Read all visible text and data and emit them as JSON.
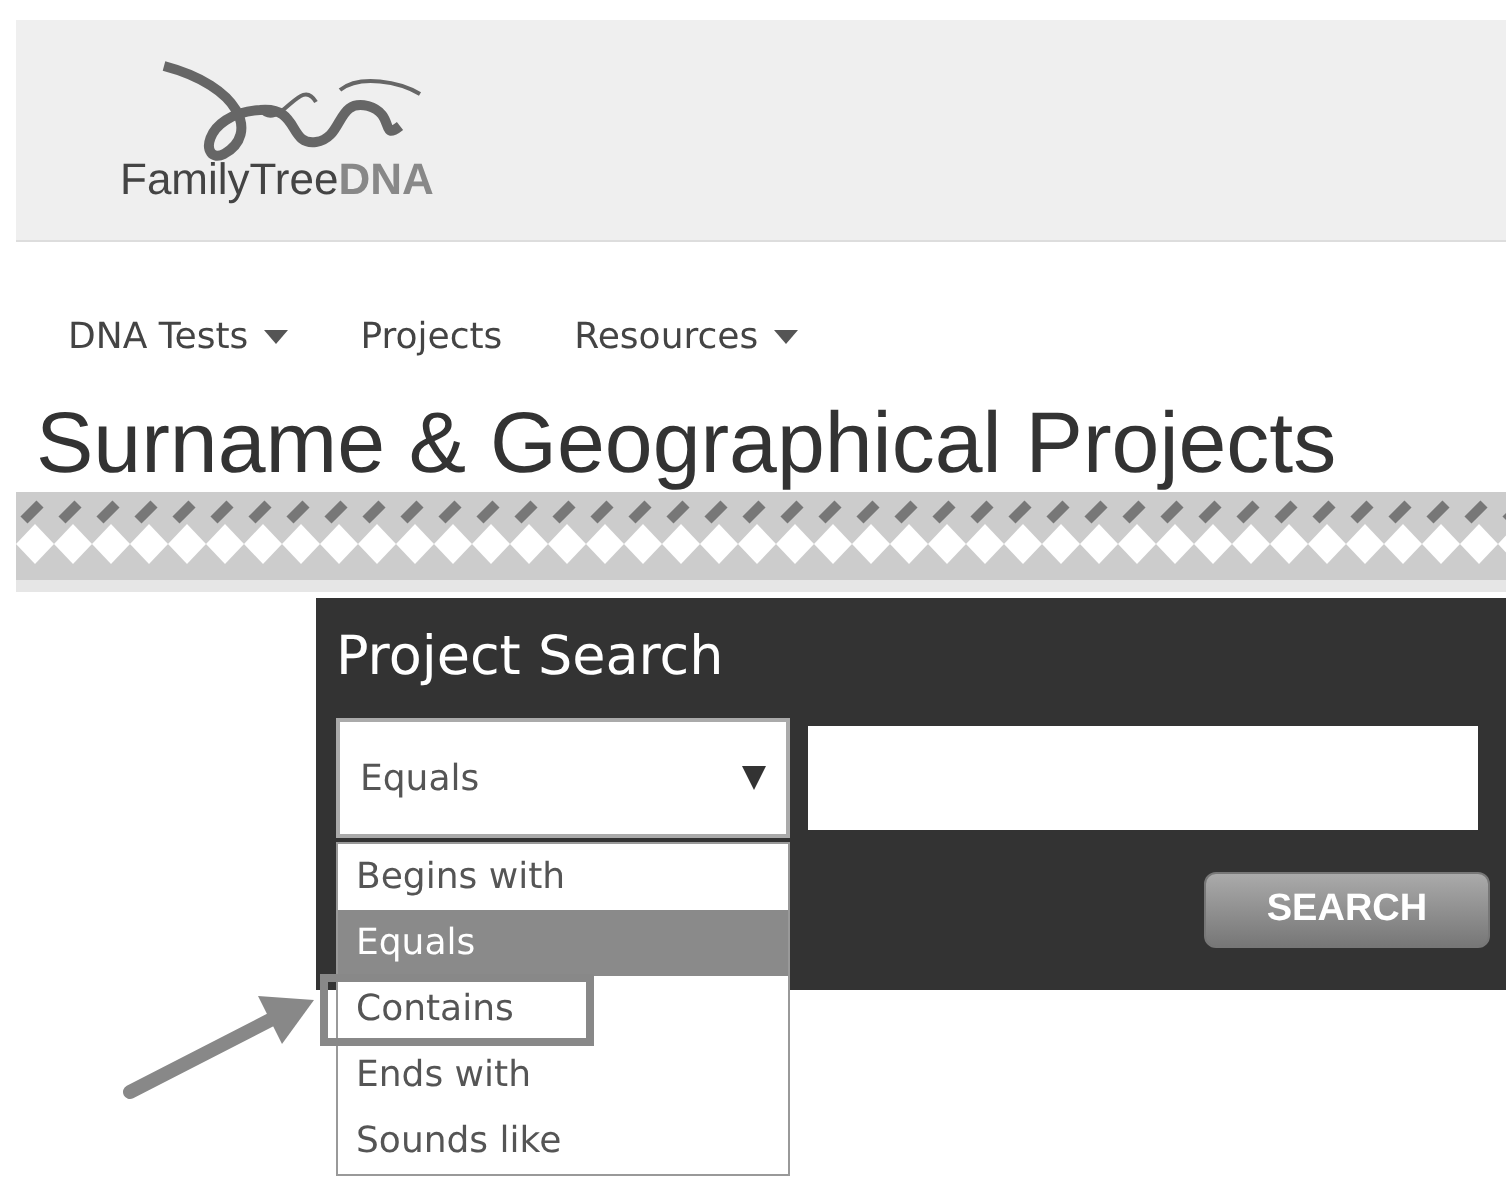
{
  "logo": {
    "text_light": "FamilyTree",
    "text_bold": "DNA"
  },
  "nav": [
    {
      "label": "DNA Tests",
      "has_menu": true
    },
    {
      "label": "Projects",
      "has_menu": false
    },
    {
      "label": "Resources",
      "has_menu": true
    }
  ],
  "page_title": "Surname & Geographical Projects",
  "project_search": {
    "title": "Project Search",
    "match_select": {
      "value": "Equals",
      "expanded": true,
      "options": [
        {
          "label": "Begins with",
          "selected": false,
          "highlighted": false
        },
        {
          "label": "Equals",
          "selected": true,
          "highlighted": false
        },
        {
          "label": "Contains",
          "selected": false,
          "highlighted": true
        },
        {
          "label": "Ends with",
          "selected": false,
          "highlighted": false
        },
        {
          "label": "Sounds like",
          "selected": false,
          "highlighted": false
        }
      ]
    },
    "search_button": "SEARCH"
  }
}
